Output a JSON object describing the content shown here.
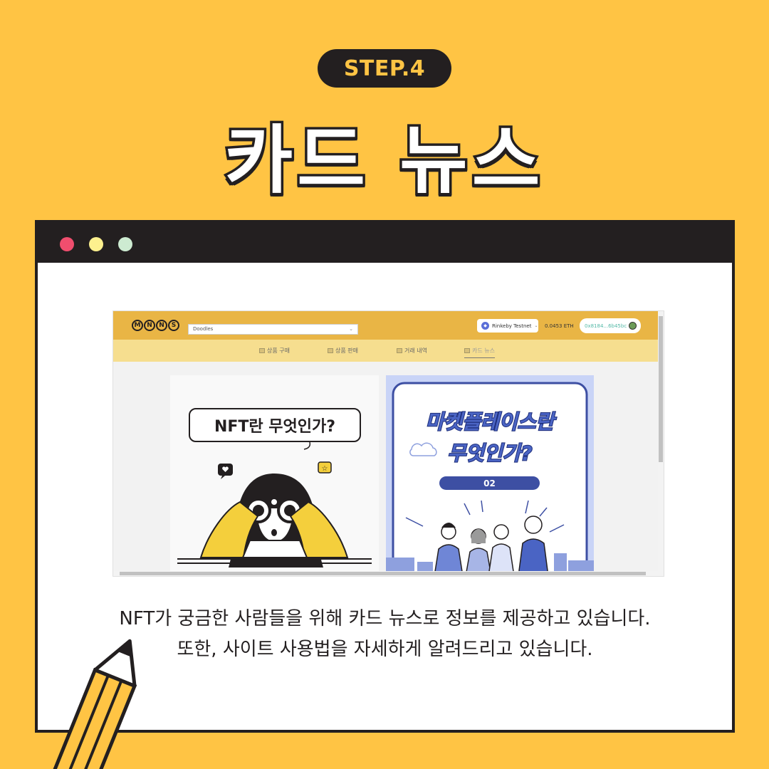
{
  "step_badge": "STEP.4",
  "title": "카드 뉴스",
  "window": {
    "dots": [
      "red",
      "yellow",
      "green"
    ]
  },
  "app": {
    "logo_letters": [
      "M",
      "N",
      "N",
      "S"
    ],
    "collection_select": "Doodles",
    "network": "Rinkeby Testnet",
    "balance": "0.0453 ETH",
    "wallet": "0x8184...6b45bc",
    "nav": [
      {
        "label": "상품 구매",
        "icon": "cart-icon",
        "active": false
      },
      {
        "label": "상품 판매",
        "icon": "image-icon",
        "active": false
      },
      {
        "label": "거래 내역",
        "icon": "document-icon",
        "active": false
      },
      {
        "label": "카드 뉴스",
        "icon": "news-icon",
        "active": true
      }
    ],
    "cards": [
      {
        "title": "NFT란 무엇인가?"
      },
      {
        "title_line1": "마켓플레이스란",
        "title_line2": "무엇인가?",
        "number": "02"
      }
    ]
  },
  "description": {
    "line1": "NFT가 궁금한 사람들을 위해 카드 뉴스로 정보를 제공하고 있습니다.",
    "line2": "또한, 사이트 사용법을 자세하게 알려드리고 있습니다."
  },
  "colors": {
    "background": "#FFC444",
    "dark": "#231F20",
    "app_header": "#E9B545",
    "app_nav": "#F6DE8F",
    "card2_bg": "#C9D4F7",
    "accent_blue": "#3D4FA3"
  }
}
